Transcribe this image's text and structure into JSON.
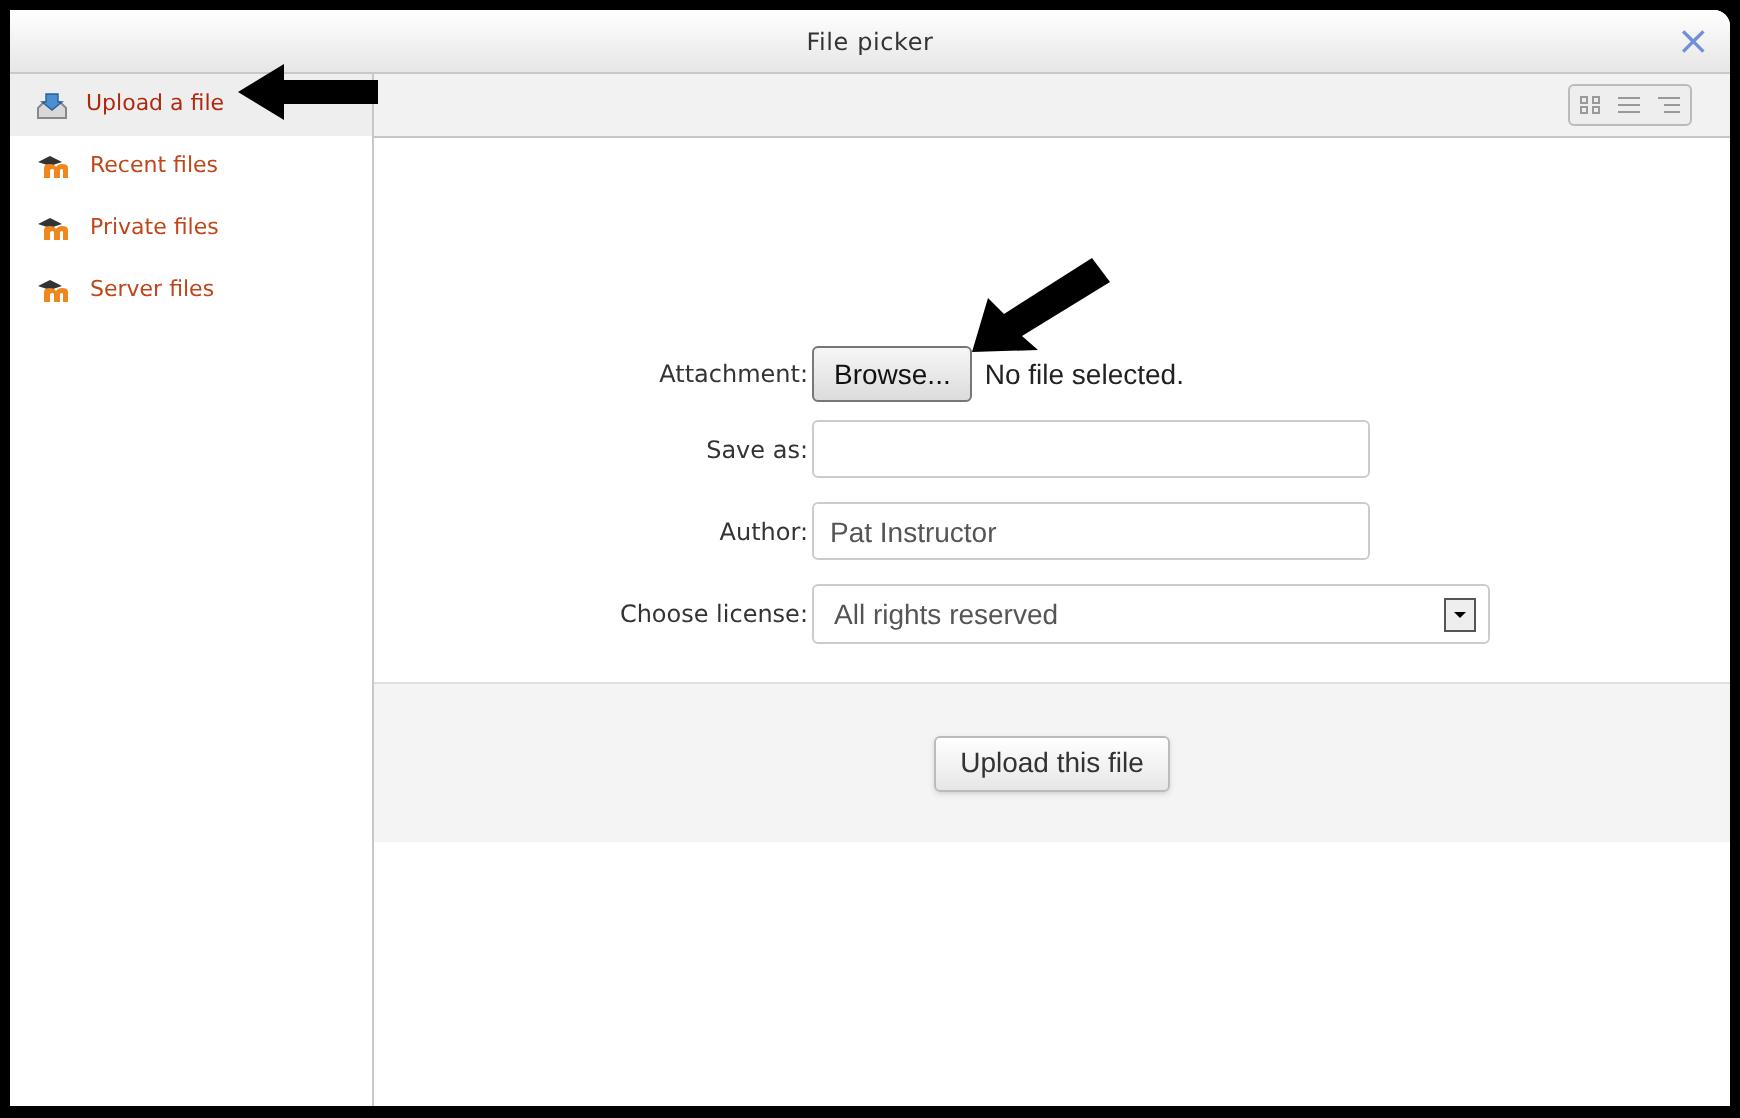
{
  "window": {
    "title": "File picker",
    "close": "×"
  },
  "sidebar": {
    "items": [
      {
        "label": "Upload a file",
        "kind": "upload",
        "selected": true
      },
      {
        "label": "Recent files",
        "kind": "repository",
        "selected": false
      },
      {
        "label": "Private files",
        "kind": "repository",
        "selected": false
      },
      {
        "label": "Server files",
        "kind": "repository",
        "selected": false
      }
    ]
  },
  "form": {
    "fields": [
      {
        "label": "Attachment:",
        "kind": "file",
        "button": "Browse...",
        "value": "No file selected."
      },
      {
        "label": "Save as:",
        "kind": "text"
      },
      {
        "label": "Author:",
        "kind": "text",
        "value": "Pat Instructor"
      },
      {
        "label": "Choose license:",
        "kind": "select",
        "value": "All rights reserved"
      }
    ],
    "submit": "Upload this file"
  }
}
